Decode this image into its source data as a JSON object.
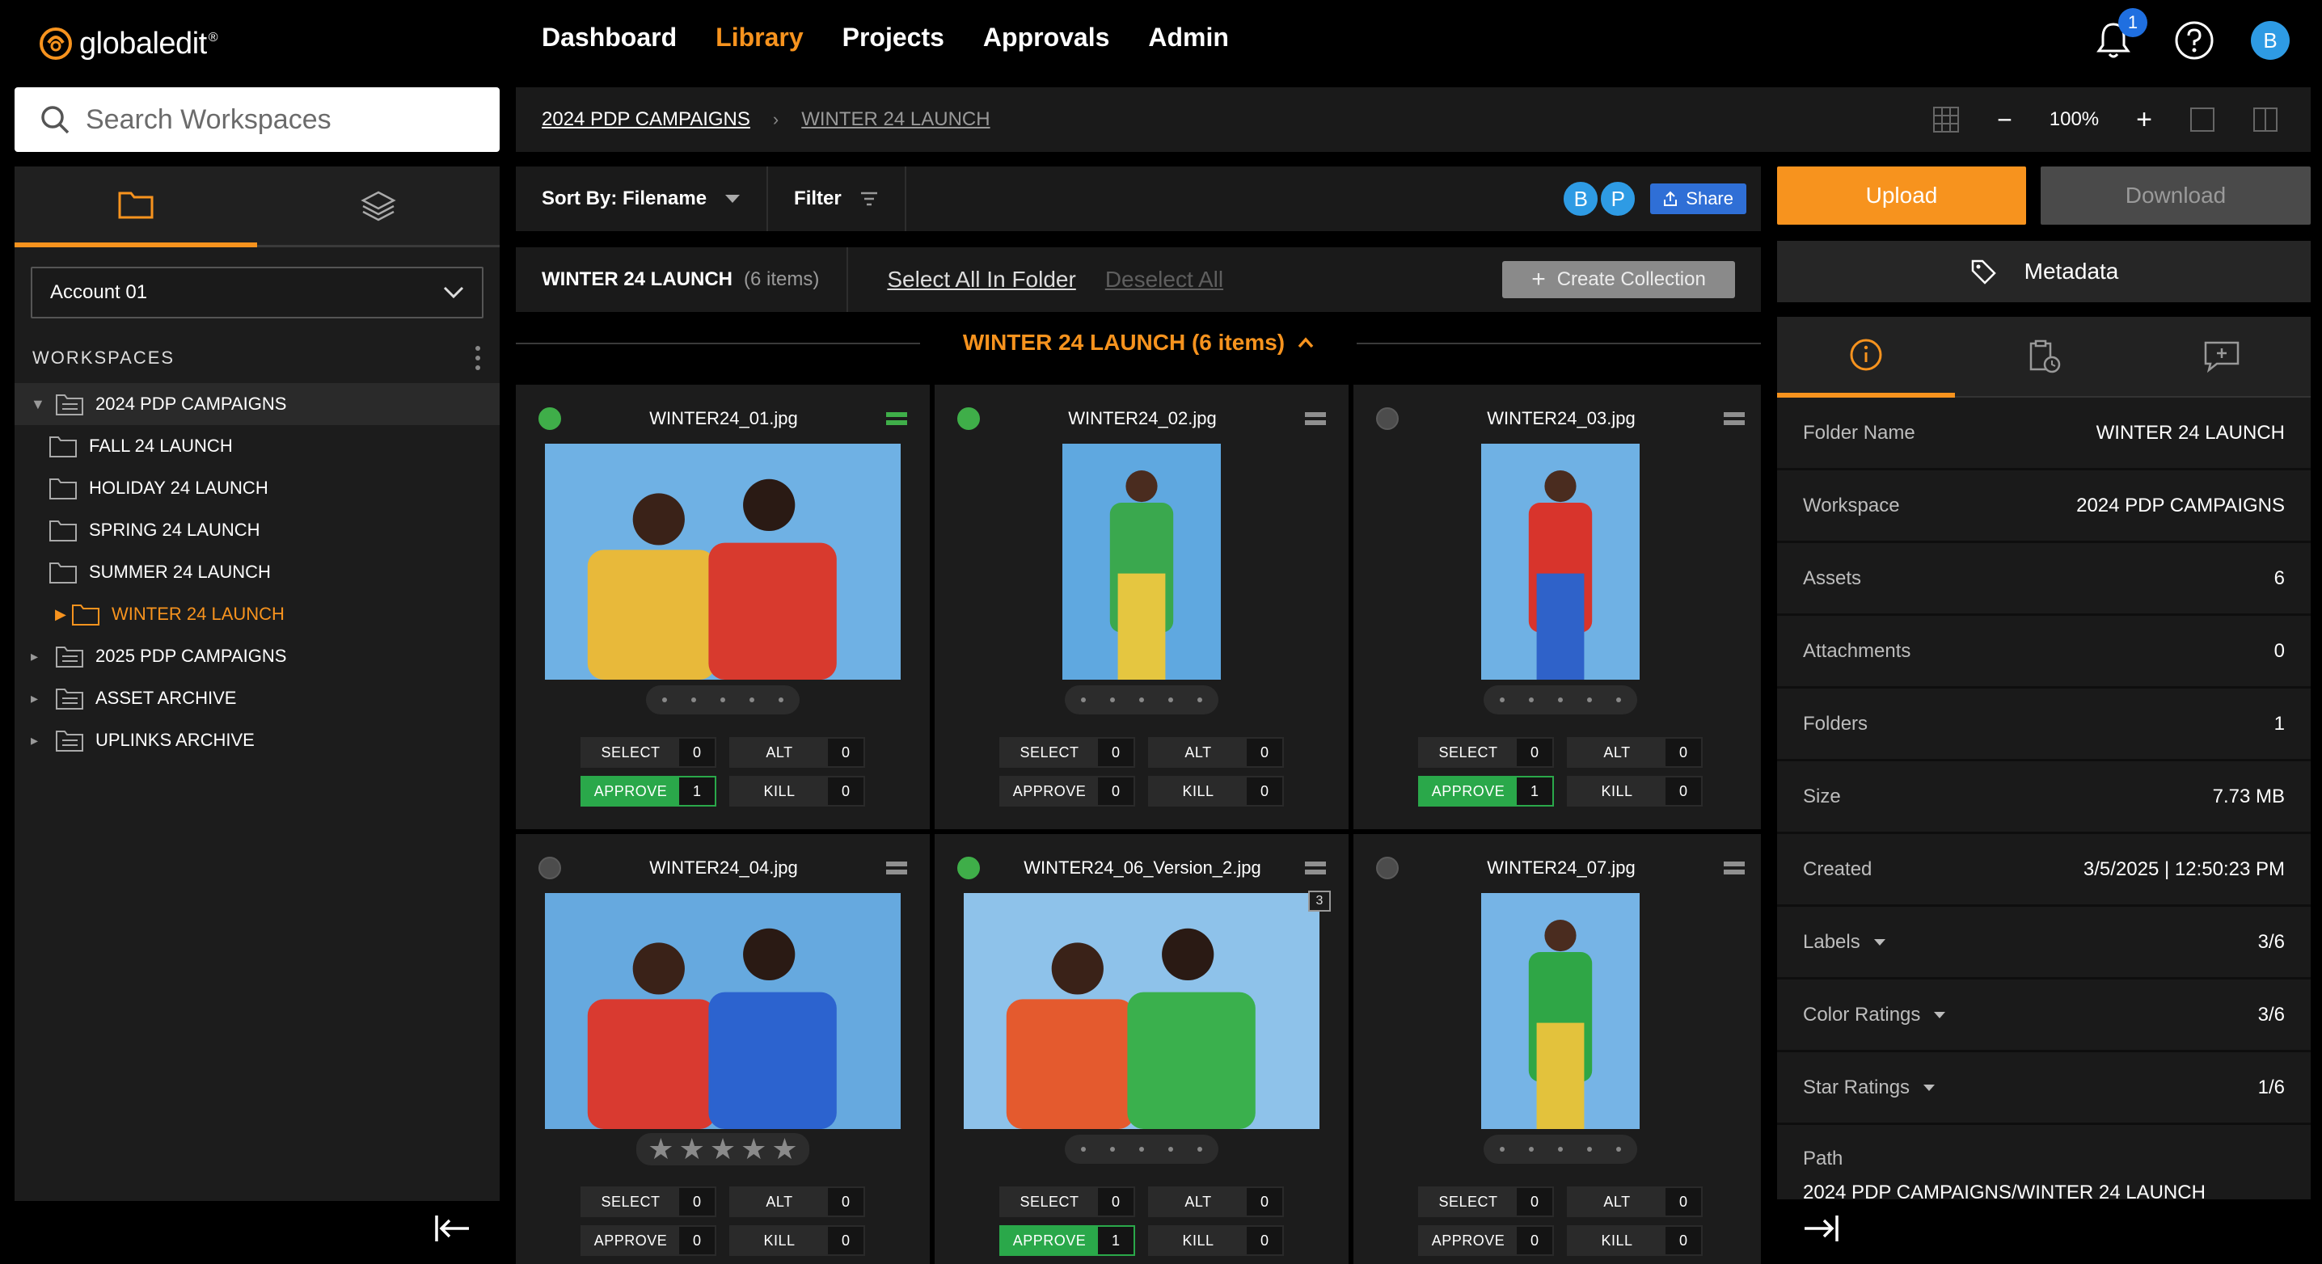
{
  "app": {
    "logo_text": "globaledit",
    "logo_mark": "®"
  },
  "nav": {
    "items": [
      {
        "label": "Dashboard",
        "active": false
      },
      {
        "label": "Library",
        "active": true
      },
      {
        "label": "Projects",
        "active": false
      },
      {
        "label": "Approvals",
        "active": false
      },
      {
        "label": "Admin",
        "active": false
      }
    ]
  },
  "topbar": {
    "notification_count": "1",
    "user_initial": "B",
    "icons": [
      "bell-icon",
      "help-icon",
      "user-avatar"
    ]
  },
  "search": {
    "placeholder": "Search Workspaces"
  },
  "sidebar": {
    "tabs": [
      "folder-icon",
      "layers-icon"
    ],
    "account": "Account 01",
    "workspaces_label": "WORKSPACES",
    "tree": [
      {
        "label": "2024 PDP CAMPAIGNS",
        "expanded": true,
        "children": [
          "FALL 24 LAUNCH",
          "HOLIDAY 24 LAUNCH",
          "SPRING 24 LAUNCH",
          "SUMMER 24 LAUNCH",
          "WINTER 24 LAUNCH"
        ]
      },
      {
        "label": "2025 PDP CAMPAIGNS"
      },
      {
        "label": "ASSET ARCHIVE"
      },
      {
        "label": "UPLINKS ARCHIVE"
      }
    ]
  },
  "breadcrumb": {
    "items": [
      "2024 PDP CAMPAIGNS",
      "WINTER 24 LAUNCH"
    ],
    "separator": "›",
    "zoom": "100%",
    "zoom_out": "−",
    "zoom_in": "+"
  },
  "sortbar": {
    "sort_label": "Sort By: Filename",
    "filter_label": "Filter",
    "avatars": [
      "B",
      "P"
    ],
    "share_label": "Share"
  },
  "selectbar": {
    "title": "WINTER 24 LAUNCH",
    "count": "(6 items)",
    "select_all": "Select All In Folder",
    "deselect_all": "Deselect All",
    "create_collection": "Create Collection"
  },
  "group": {
    "title": "WINTER 24 LAUNCH (6 items)"
  },
  "vote_labels": {
    "select": "SELECT",
    "alt": "ALT",
    "approve": "APPROVE",
    "kill": "KILL"
  },
  "assets": [
    {
      "filename": "WINTER24_01.jpg",
      "selected": true,
      "menu_green": true,
      "rating": "dots",
      "select": "0",
      "alt": "0",
      "approve": "1",
      "kill": "0",
      "approved": true,
      "colors": {
        "bg": "#6fb1e4",
        "a": "#e8b93a",
        "b": "#d83a2e"
      },
      "portrait": false
    },
    {
      "filename": "WINTER24_02.jpg",
      "selected": true,
      "menu_green": false,
      "rating": "dots",
      "select": "0",
      "alt": "0",
      "approve": "0",
      "kill": "0",
      "approved": false,
      "colors": {
        "bg": "#5fa8e0",
        "a": "#3aa84e",
        "b": "#e5c640"
      },
      "portrait": true
    },
    {
      "filename": "WINTER24_03.jpg",
      "selected": false,
      "menu_green": false,
      "rating": "dots",
      "select": "0",
      "alt": "0",
      "approve": "1",
      "kill": "0",
      "approved": true,
      "colors": {
        "bg": "#6fb1e4",
        "a": "#d8342c",
        "b": "#2f62c9"
      },
      "portrait": true
    },
    {
      "filename": "WINTER24_04.jpg",
      "selected": false,
      "menu_green": false,
      "rating": "stars",
      "select": "0",
      "alt": "0",
      "approve": "0",
      "kill": "0",
      "approved": false,
      "colors": {
        "bg": "#66a9df",
        "a": "#d93a30",
        "b": "#2c63cf"
      },
      "portrait": false
    },
    {
      "filename": "WINTER24_06_Version_2.jpg",
      "selected": true,
      "menu_green": false,
      "rating": "dots",
      "select": "0",
      "alt": "0",
      "approve": "1",
      "kill": "0",
      "approved": true,
      "version": "3",
      "colors": {
        "bg": "#8ec2ea",
        "a": "#e45a2e",
        "b": "#3ab04d"
      },
      "portrait": false
    },
    {
      "filename": "WINTER24_07.jpg",
      "selected": false,
      "menu_green": false,
      "rating": "dots",
      "select": "0",
      "alt": "0",
      "approve": "0",
      "kill": "0",
      "approved": false,
      "colors": {
        "bg": "#76b4e6",
        "a": "#2fa646",
        "b": "#e3c23c"
      },
      "portrait": true
    }
  ],
  "actions": {
    "upload": "Upload",
    "download": "Download",
    "metadata": "Metadata"
  },
  "info_panel": {
    "tabs": [
      "info-icon",
      "history-icon",
      "comment-icon"
    ],
    "rows": [
      {
        "key": "Folder Name",
        "value": "WINTER 24 LAUNCH"
      },
      {
        "key": "Workspace",
        "value": "2024 PDP CAMPAIGNS"
      },
      {
        "key": "Assets",
        "value": "6"
      },
      {
        "key": "Attachments",
        "value": "0"
      },
      {
        "key": "Folders",
        "value": "1"
      },
      {
        "key": "Size",
        "value": "7.73 MB"
      },
      {
        "key": "Created",
        "value": "3/5/2025 | 12:50:23 PM"
      },
      {
        "key": "Labels",
        "value": "3/6",
        "dropdown": true
      },
      {
        "key": "Color Ratings",
        "value": "3/6",
        "dropdown": true
      },
      {
        "key": "Star Ratings",
        "value": "1/6",
        "dropdown": true
      }
    ],
    "path_label": "Path",
    "path_value": "2024 PDP CAMPAIGNS/WINTER 24 LAUNCH"
  },
  "colors": {
    "accent": "#f7931e",
    "approve": "#2aa84a",
    "share": "#2f6fd6"
  }
}
